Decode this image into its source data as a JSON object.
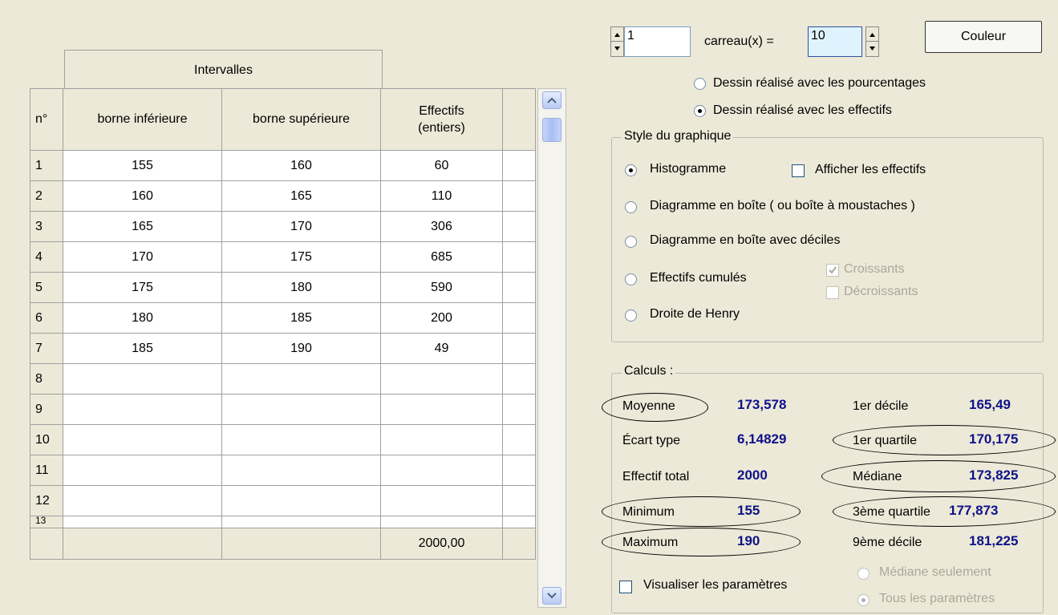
{
  "table": {
    "group_header": "Intervalles",
    "columns": {
      "index": "n°",
      "lower": "borne inférieure",
      "upper": "borne supérieure",
      "count_line1": "Effectifs",
      "count_line2": "(entiers)"
    },
    "rows": [
      {
        "n": "1",
        "lower": "155",
        "upper": "160",
        "count": "60"
      },
      {
        "n": "2",
        "lower": "160",
        "upper": "165",
        "count": "110"
      },
      {
        "n": "3",
        "lower": "165",
        "upper": "170",
        "count": "306"
      },
      {
        "n": "4",
        "lower": "170",
        "upper": "175",
        "count": "685"
      },
      {
        "n": "5",
        "lower": "175",
        "upper": "180",
        "count": "590"
      },
      {
        "n": "6",
        "lower": "180",
        "upper": "185",
        "count": "200"
      },
      {
        "n": "7",
        "lower": "185",
        "upper": "190",
        "count": "49"
      },
      {
        "n": "8",
        "lower": "",
        "upper": "",
        "count": ""
      },
      {
        "n": "9",
        "lower": "",
        "upper": "",
        "count": ""
      },
      {
        "n": "10",
        "lower": "",
        "upper": "",
        "count": ""
      },
      {
        "n": "11",
        "lower": "",
        "upper": "",
        "count": ""
      },
      {
        "n": "12",
        "lower": "",
        "upper": "",
        "count": ""
      }
    ],
    "partial_row": "13",
    "total": "2000,00"
  },
  "scale": {
    "value1": "1",
    "label": "carreau(x) =",
    "value2": "10",
    "color_button": "Couleur"
  },
  "drawing_mode": {
    "pct": "Dessin réalisé avec les pourcentages",
    "counts": "Dessin réalisé avec les effectifs"
  },
  "style": {
    "title": "Style du graphique",
    "histogram": "Histogramme",
    "show_counts": "Afficher les effectifs",
    "boxplot": "Diagramme en boîte ( ou boîte à moustaches )",
    "boxplot_deciles": "Diagramme en boîte avec déciles",
    "cumulative": "Effectifs cumulés",
    "increasing": "Croissants",
    "decreasing": "Décroissants",
    "henry": "Droite de Henry"
  },
  "calc": {
    "title": "Calculs :",
    "mean_label": "Moyenne",
    "mean": "173,578",
    "sd_label": "Écart type",
    "sd": "6,14829",
    "total_label": "Effectif total",
    "total": "2000",
    "min_label": "Minimum",
    "min": "155",
    "max_label": "Maximum",
    "max": "190",
    "d1_label": "1er décile",
    "d1": "165,49",
    "q1_label": "1er quartile",
    "q1": "170,175",
    "median_label": "Médiane",
    "median": "173,825",
    "q3_label": "3ème quartile",
    "q3": "177,873",
    "d9_label": "9ème décile",
    "d9": "181,225",
    "visualize": "Visualiser les paramètres",
    "median_only": "Médiane seulement",
    "all_params": "Tous les paramètres"
  }
}
